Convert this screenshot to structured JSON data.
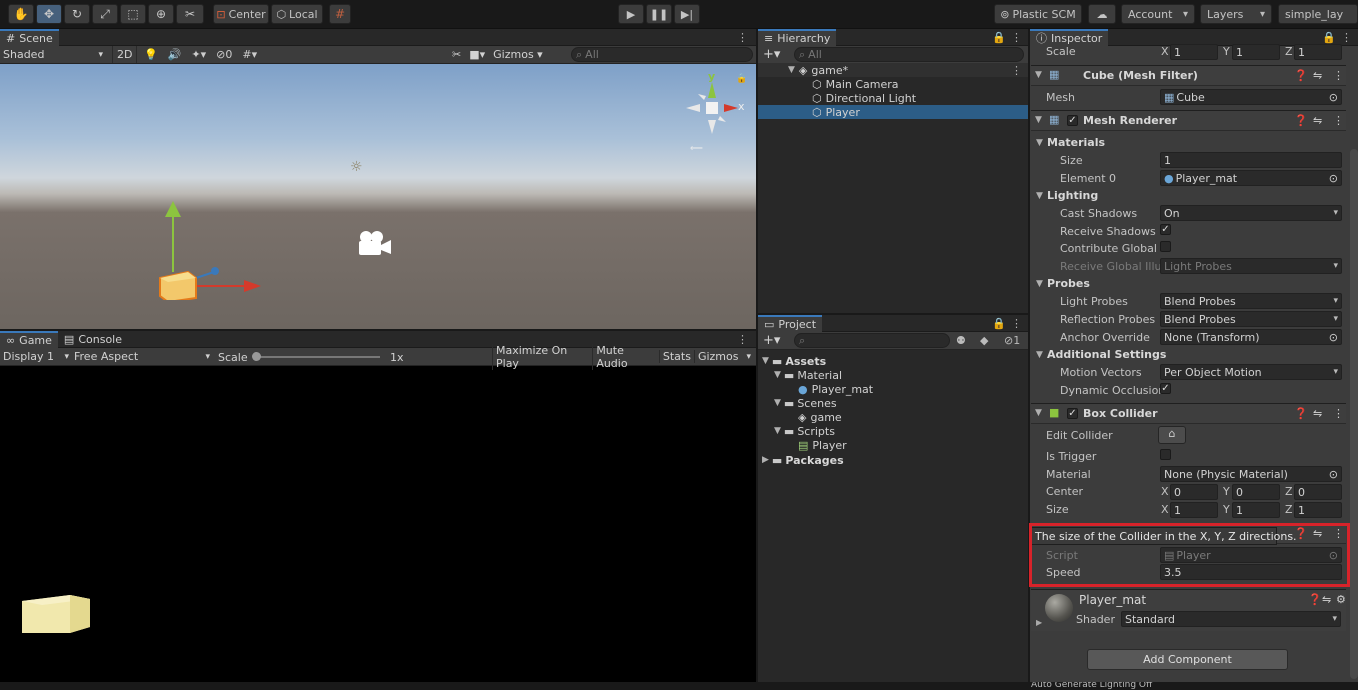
{
  "toolbar": {
    "center_label": "Center",
    "local_label": "Local",
    "plastic_label": "Plastic SCM",
    "account_label": "Account",
    "layers_label": "Layers",
    "layout_label": "simple_lay"
  },
  "scene": {
    "tab": "Scene",
    "shading": "Shaded",
    "mode_2d": "2D",
    "hidden_count": "0",
    "gizmos": "Gizmos",
    "search_placeholder": "All",
    "axis_y": "y",
    "axis_x": "x"
  },
  "game": {
    "tab": "Game",
    "console_tab": "Console",
    "display": "Display 1",
    "aspect": "Free Aspect",
    "scale_label": "Scale",
    "scale_value": "1x",
    "maximize": "Maximize On Play",
    "mute": "Mute Audio",
    "stats": "Stats",
    "gizmos": "Gizmos"
  },
  "hierarchy": {
    "tab": "Hierarchy",
    "search_placeholder": "All",
    "scene_name": "game*",
    "items": [
      "Main Camera",
      "Directional Light",
      "Player"
    ],
    "selected": "Player"
  },
  "project": {
    "tab": "Project",
    "hidden_count": "1",
    "assets": "Assets",
    "material_folder": "Material",
    "material_item": "Player_mat",
    "scenes_folder": "Scenes",
    "scene_item": "game",
    "scripts_folder": "Scripts",
    "script_item": "Player",
    "packages": "Packages"
  },
  "inspector": {
    "tab": "Inspector",
    "scale": {
      "label": "Scale",
      "x": "1",
      "y": "1",
      "z": "1"
    },
    "mesh_filter": {
      "title": "Cube (Mesh Filter)",
      "mesh_label": "Mesh",
      "mesh_value": "Cube"
    },
    "mesh_renderer": {
      "title": "Mesh Renderer",
      "materials": "Materials",
      "size_label": "Size",
      "size_value": "1",
      "element0_label": "Element 0",
      "element0_value": "Player_mat",
      "lighting": "Lighting",
      "cast_shadows_label": "Cast Shadows",
      "cast_shadows_value": "On",
      "receive_shadows_label": "Receive Shadows",
      "contribute_gi_label": "Contribute Global Il",
      "receive_gi_label": "Receive Global Illur",
      "receive_gi_value": "Light Probes",
      "probes": "Probes",
      "light_probes_label": "Light Probes",
      "light_probes_value": "Blend Probes",
      "reflection_probes_label": "Reflection Probes",
      "reflection_probes_value": "Blend Probes",
      "anchor_override_label": "Anchor Override",
      "anchor_override_value": "None (Transform)",
      "additional": "Additional Settings",
      "motion_vectors_label": "Motion Vectors",
      "motion_vectors_value": "Per Object Motion",
      "dynamic_occlusion_label": "Dynamic Occlusion"
    },
    "box_collider": {
      "title": "Box Collider",
      "edit_collider": "Edit Collider",
      "is_trigger": "Is Trigger",
      "material_label": "Material",
      "material_value": "None (Physic Material)",
      "center_label": "Center",
      "center": {
        "x": "0",
        "y": "0",
        "z": "0"
      },
      "size_label": "Size",
      "size": {
        "x": "1",
        "y": "1",
        "z": "1"
      }
    },
    "tooltip": "The size of the Collider in the X, Y, Z directions.",
    "player_script": {
      "script_label": "Script",
      "script_value": "Player",
      "speed_label": "Speed",
      "speed_value": "3.5"
    },
    "material": {
      "name": "Player_mat",
      "shader_label": "Shader",
      "shader_value": "Standard"
    },
    "add_component": "Add Component"
  },
  "status": {
    "text": "Auto Generate Lighting Off"
  },
  "colors": {
    "accent": "#3a79bb",
    "selection": "#2c5d87",
    "highlight_box": "#d8232a"
  }
}
